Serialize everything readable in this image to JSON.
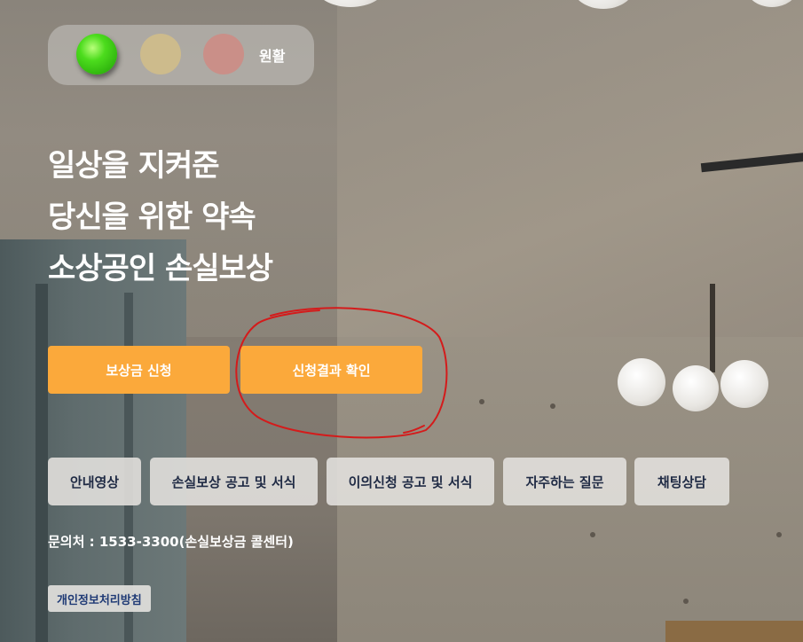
{
  "status": {
    "label": "원활",
    "lights": [
      {
        "name": "green",
        "active": true,
        "color": "#3fd016"
      },
      {
        "name": "yellow",
        "active": false,
        "color": "#d2be88"
      },
      {
        "name": "red",
        "active": false,
        "color": "#cf8b84"
      }
    ]
  },
  "hero": {
    "line1": "일상을 지켜준",
    "line2": "당신을 위한 약속",
    "line3": "소상공인 손실보상"
  },
  "primary_buttons": {
    "apply": "보상금 신청",
    "check_result": "신청결과 확인",
    "accent_color": "#fba93b"
  },
  "sub_buttons": [
    {
      "label": "안내영상"
    },
    {
      "label": "손실보상 공고 및 서식"
    },
    {
      "label": "이의신청 공고 및 서식"
    },
    {
      "label": "자주하는 질문"
    },
    {
      "label": "채팅상담"
    }
  ],
  "contact": "문의처 : 1533-3300(손실보상금 콜센터)",
  "privacy_link": "개인정보처리방침",
  "annotation": {
    "color": "#d41b1b",
    "shape": "hand-drawn-ellipse"
  }
}
